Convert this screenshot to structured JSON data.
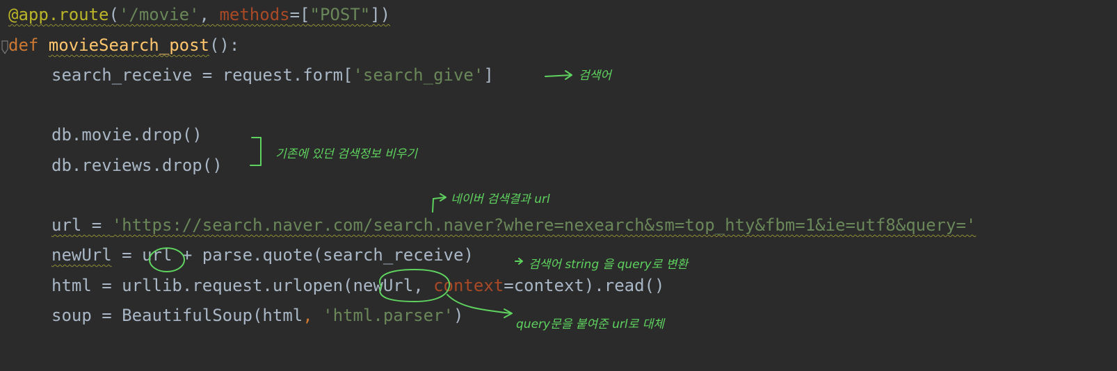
{
  "code": {
    "l1": {
      "deco": "@app.route",
      "p1": "(",
      "s1": "'/movie'",
      "p2": ", ",
      "kwarg": "methods",
      "p3": "=[",
      "s2": "\"POST\"",
      "p4": "])"
    },
    "l2": {
      "kw": "def ",
      "fn": "movieSearch_post",
      "rest": "():"
    },
    "l3": {
      "a": "search_receive = request.form[",
      "s": "'search_give'",
      "b": "]"
    },
    "l5": {
      "a": "db.movie.drop()"
    },
    "l6": {
      "a": "db.reviews.drop()"
    },
    "l8": {
      "a": "url = ",
      "s": "'https://search.naver.com/search.naver?where=nexearch&sm=top_hty&fbm=1&ie=utf8&query='"
    },
    "l9": {
      "a": "newUrl",
      "b": " = ",
      "c": "url",
      "d": " + parse.quote(search_receive)"
    },
    "l10": {
      "a": "html = urllib.request.urlopen(",
      "b": "newUrl",
      "c": ", ",
      "kwarg": "context",
      "d": "=context).read()"
    },
    "l11": {
      "a": "soup = BeautifulSoup(html",
      "c": ", ",
      "s": "'html.parser'",
      "d": ")"
    }
  },
  "annotations": {
    "search_word": "검색어",
    "clear_old": "기존에 있던 검색정보 비우기",
    "naver_url": "네이버 검색결과 url",
    "convert": "검색어 string 을 query로 변환",
    "replace": "query문을 붙여준 url로 대체"
  },
  "colors": {
    "background": "#2b2b2b",
    "keyword": "#cc7832",
    "function": "#ffc66d",
    "string": "#6a8759",
    "decorator": "#bbb529",
    "parameter": "#aa4926",
    "handwriting": "#5fd35f"
  }
}
